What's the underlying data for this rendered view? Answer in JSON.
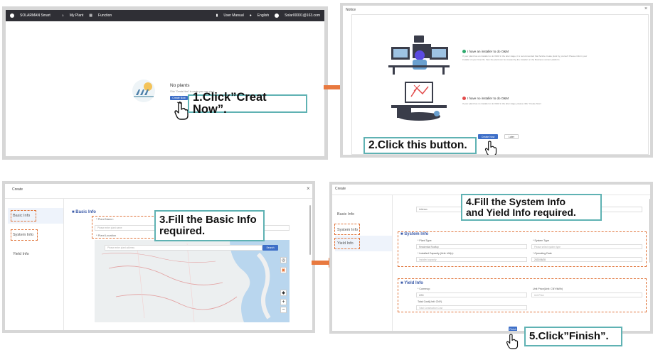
{
  "panel1": {
    "app_name": "SOLARMAN Smart",
    "nav_my_plant": "My Plant",
    "nav_function": "Function",
    "user_manual": "User Manual",
    "language": "English",
    "user_name": "Solar00001@163.com",
    "no_plants_title": "No plants",
    "no_plants_hint": "Click \"Create Now\" to create your own plant.",
    "create_now_button": "Create Now",
    "callout": "1.Click”Creat Now”."
  },
  "panel2": {
    "dialog_title": "Notice",
    "option1_title": "I have an installer to do O&M",
    "option1_desc_line1": "If your plant has an installer to do O&M in the later stage, it is recommended that he/she create plant by yourself. Please inform your",
    "option1_desc_line2": "installer of your User ID, then the plant can be created by the installer on the Business version platform.",
    "option2_title": "I have no installer to do O&M",
    "option2_desc": "If your plant has no installer to do O&M in the later stage, please click \"Create Now\".",
    "create_now_button": "Create Now",
    "later_button": "Later",
    "callout": "2.Click this button."
  },
  "panel3": {
    "dialog_title": "Create",
    "sidebar": [
      "Basic Info",
      "System Info",
      "Yield Info"
    ],
    "section_title": "Basic Info",
    "plant_name_label": "* Plant Name:",
    "plant_name_placeholder": "Please enter plant name",
    "plant_location_label": "* Plant Location",
    "location_placeholder": "Please enter plant address",
    "search_button": "Search",
    "callout_line1": "3.Fill the Basic Info",
    "callout_line2": "required."
  },
  "panel4": {
    "dialog_title": "Create",
    "sidebar": [
      "Basic Info",
      "System Info",
      "Yield Info"
    ],
    "top_select_value": "Address",
    "system_section_title": "System Info",
    "plant_type_label": "* Plant Type:",
    "plant_type_value": "Residential Rooftop",
    "system_type_label": "* System Type",
    "system_type_placeholder": "Please select system type",
    "capacity_label": "* Installed Capacity (Unit: kWp):",
    "capacity_placeholder": "Installed capacity",
    "operating_date_label": "* Operating Date",
    "operating_date_value": "2023/06/28",
    "yield_section_title": "Yield Info",
    "currency_label": "* Currency:",
    "currency_value": "USD",
    "unit_price_label": "Unit Price(Unit: CNY/kWh)",
    "unit_price_placeholder": "Unit Price",
    "total_cost_label": "Total Cost(Unit: CNY)",
    "total_cost_placeholder": "Total Construction Cost",
    "finish_button": "Finish",
    "callout_line1": "4.Fill the System Info",
    "callout_line2": "and Yield Info required.",
    "finish_callout": "5.Click”Finish”."
  },
  "colors": {
    "accent": "#3e6fc8",
    "callout_border": "#5fb2b3",
    "arrow": "#e8793f",
    "dashed": "#e0743a"
  }
}
